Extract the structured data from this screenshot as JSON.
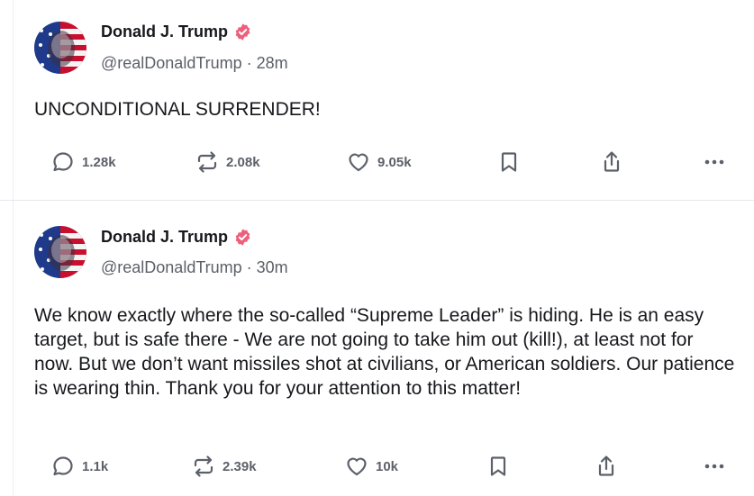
{
  "posts": [
    {
      "author_name": "Donald J. Trump",
      "handle_time": "@realDonaldTrump · 28m",
      "text": "UNCONDITIONAL SURRENDER!",
      "replies": "1.28k",
      "reposts": "2.08k",
      "likes": "9.05k"
    },
    {
      "author_name": "Donald J. Trump",
      "handle_time": "@realDonaldTrump · 30m",
      "text": "We know exactly where the so-called “Supreme Leader” is hiding. He is an easy target, but is safe there - We are not going to take him out (kill!), at least not for now. But we don’t want missiles shot at civilians, or American soldiers. Our patience is wearing thin. Thank you for your attention to this matter!",
      "replies": "1.1k",
      "reposts": "2.39k",
      "likes": "10k"
    }
  ],
  "icons": {
    "reply": "reply-icon",
    "repost": "repost-icon",
    "like": "heart-icon",
    "save": "bookmark-icon",
    "share": "share-icon",
    "more": "more-icon",
    "verified": "verified-badge-icon"
  },
  "colors": {
    "verified_badge": "#ee5f7b",
    "text": "#17181c",
    "muted": "#5c6069",
    "divider": "#e6e8eb"
  }
}
